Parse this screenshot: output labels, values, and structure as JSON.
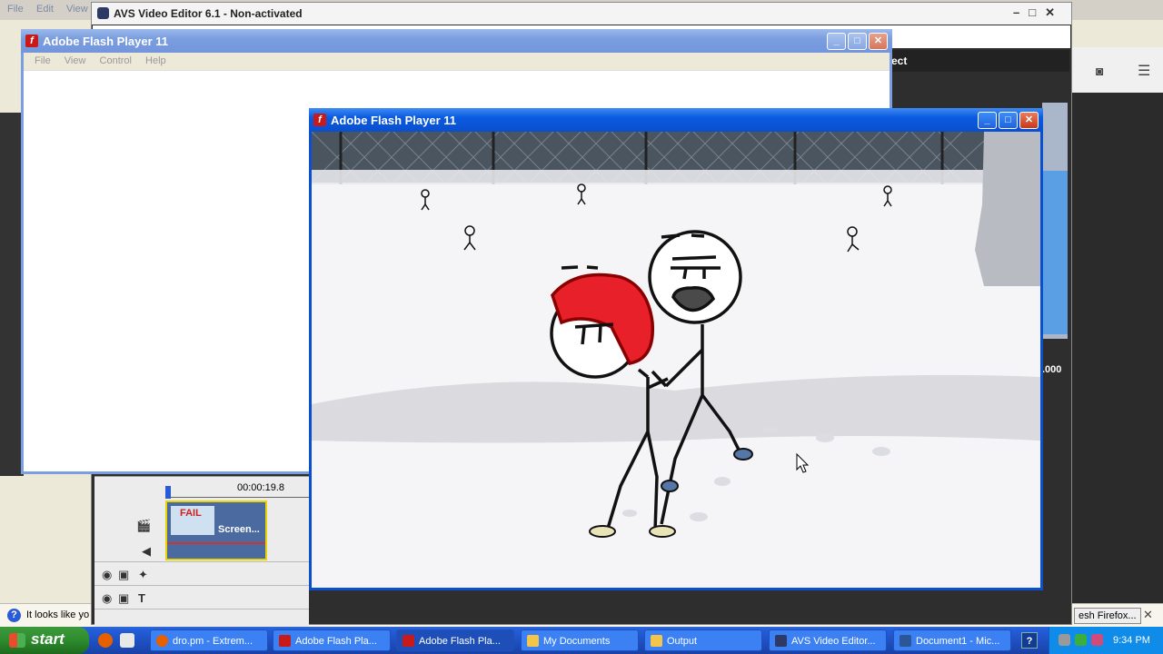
{
  "background": {
    "menu": [
      "File",
      "Edit",
      "View"
    ],
    "notification": "It looks like yo",
    "firefox_button": "esh Firefox...",
    "close_symbol": "✕"
  },
  "avs": {
    "title": "AVS Video Editor 6.1 - Non-activated",
    "bar_label": "ect",
    "time_readout": ".000",
    "timeline_time": "00:00:19.8",
    "clip_name": "Screen...",
    "clip_thumb_text": "FAIL"
  },
  "flash1": {
    "title": "Adobe Flash Player 11",
    "menu": [
      "File",
      "View",
      "Control",
      "Help"
    ]
  },
  "flash2": {
    "title": "Adobe Flash Player 11"
  },
  "taskbar": {
    "start": "start",
    "tasks": [
      {
        "label": "dro.pm - Extrem...",
        "color": "#e66000"
      },
      {
        "label": "Adobe Flash Pla...",
        "color": "#c81a1a"
      },
      {
        "label": "Adobe Flash Pla...",
        "color": "#c81a1a"
      },
      {
        "label": "My Documents",
        "color": "#f3c64b"
      },
      {
        "label": "Output",
        "color": "#f3c64b"
      },
      {
        "label": "AVS Video Editor...",
        "color": "#2d3a66"
      },
      {
        "label": "Document1 - Mic...",
        "color": "#2b5797"
      }
    ],
    "clock": "9:34 PM"
  },
  "colors": {
    "xp_blue": "#0a4fd0",
    "hair_red": "#e8202a"
  }
}
